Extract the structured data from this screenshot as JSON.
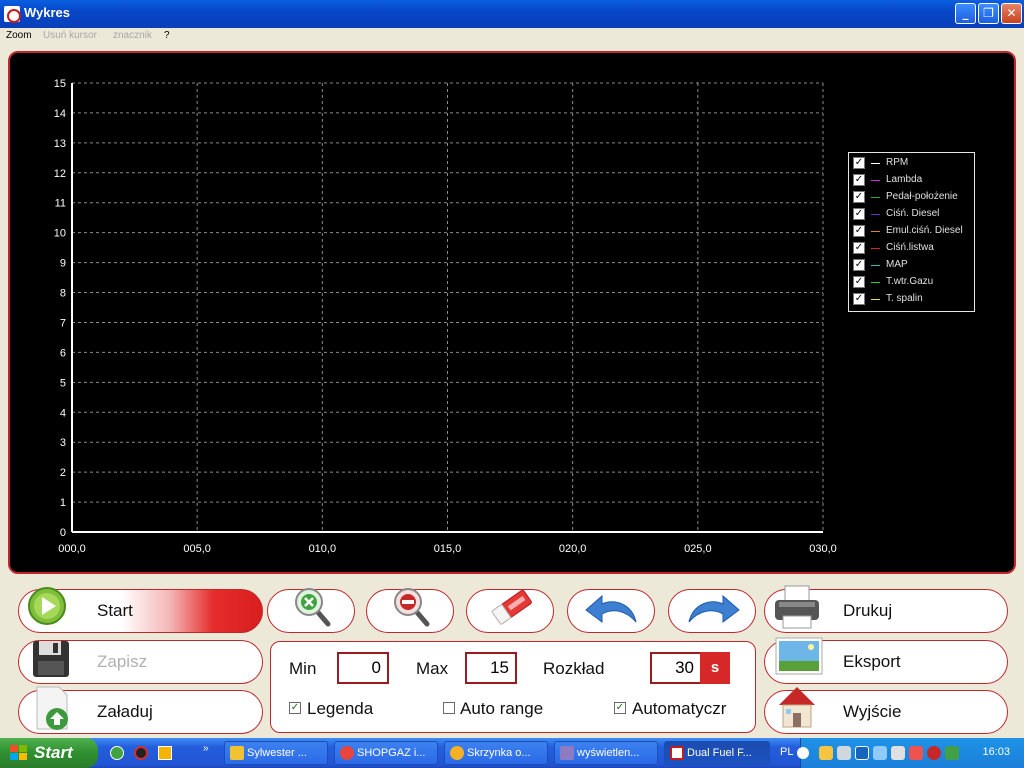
{
  "window": {
    "title": "Wykres"
  },
  "menu": [
    {
      "label": "Zoom",
      "enabled": true
    },
    {
      "label": "Usuń kursor",
      "enabled": false
    },
    {
      "label": "znacznik",
      "enabled": false
    },
    {
      "label": "?",
      "enabled": true
    }
  ],
  "chart_data": {
    "type": "line",
    "x_ticks": [
      "000,0",
      "005,0",
      "010,0",
      "015,0",
      "020,0",
      "025,0",
      "030,0"
    ],
    "y_ticks": [
      "0",
      "1",
      "2",
      "3",
      "4",
      "5",
      "6",
      "7",
      "8",
      "9",
      "10",
      "11",
      "12",
      "13",
      "14",
      "15"
    ],
    "xlim": [
      0,
      30
    ],
    "ylim": [
      0,
      15
    ],
    "grid": true,
    "legend_position": "right",
    "series": [
      {
        "name": "RPM",
        "color": "#ffffff",
        "checked": true,
        "values": []
      },
      {
        "name": "Lambda",
        "color": "#d02bd0",
        "checked": true,
        "values": []
      },
      {
        "name": "Pedał-położenie",
        "color": "#2aa92a",
        "checked": true,
        "values": []
      },
      {
        "name": "Ciśń. Diesel",
        "color": "#6a2bd0",
        "checked": true,
        "values": []
      },
      {
        "name": "Emul.ciśń. Diesel",
        "color": "#d98a2b",
        "checked": true,
        "values": []
      },
      {
        "name": "Ciśń.listwa",
        "color": "#e02020",
        "checked": true,
        "values": []
      },
      {
        "name": "MAP",
        "color": "#22c0c0",
        "checked": true,
        "values": []
      },
      {
        "name": "T.wtr.Gazu",
        "color": "#2bd02b",
        "checked": true,
        "values": []
      },
      {
        "name": "T. spalin",
        "color": "#e6e62b",
        "checked": true,
        "values": []
      }
    ]
  },
  "controls": {
    "start_label": "Start",
    "save_label": "Zapisz",
    "load_label": "Załaduj",
    "print_label": "Drukuj",
    "export_label": "Eksport",
    "exit_label": "Wyjście"
  },
  "settings": {
    "min_label": "Min",
    "min_value": "0",
    "max_label": "Max",
    "max_value": "15",
    "span_label": "Rozkład",
    "span_value": "30",
    "span_unit": "s",
    "legend_label": "Legenda",
    "legend_checked": true,
    "autorange_label": "Auto range",
    "autorange_checked": false,
    "auto_label": "Automatyczr",
    "auto_checked": true
  },
  "taskbar": {
    "start_label": "Start",
    "tasks": [
      {
        "label": "Sylwester ...",
        "color": "#f1c232"
      },
      {
        "label": "SHOPGAZ i...",
        "color": "#e8453c"
      },
      {
        "label": "Skrzynka o...",
        "color": "#f6b026"
      },
      {
        "label": "wyświetlen...",
        "color": "#8e7cc3"
      },
      {
        "label": "Dual Fuel F...",
        "color": "#ffffff"
      }
    ],
    "language": "PL",
    "clock": "16:03"
  }
}
